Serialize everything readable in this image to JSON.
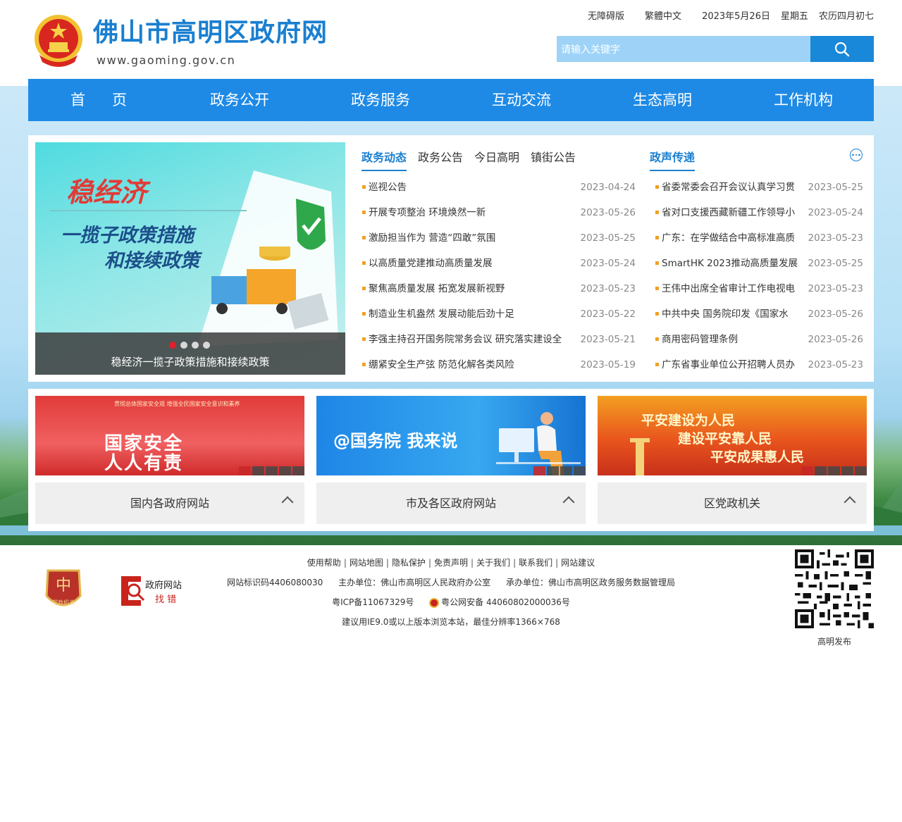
{
  "header": {
    "site_title": "佛山市高明区政府网",
    "site_url": "www.gaoming.gov.cn",
    "top_links": {
      "accessibility": "无障碍版",
      "traditional": "繁體中文",
      "date": "2023年5月26日",
      "weekday": "星期五",
      "lunar": "农历四月初七"
    },
    "search": {
      "placeholder": "请输入关键字"
    }
  },
  "nav": {
    "items": [
      "首页",
      "政务公开",
      "政务服务",
      "互动交流",
      "生态高明",
      "工作机构"
    ]
  },
  "banner": {
    "title": "稳经济",
    "subtitle_line1": "一揽子政策措施",
    "subtitle_line2": "和接续政策",
    "caption": "稳经济一揽子政策措施和接续政策",
    "slide_count": 4,
    "active_slide": 1
  },
  "news_tabs": {
    "left": [
      "政务动态",
      "政务公告",
      "今日高明",
      "镇街公告"
    ],
    "right": [
      "政声传递"
    ]
  },
  "news_left": [
    {
      "title": "巡视公告",
      "date": "2023-04-24"
    },
    {
      "title": "开展专项整治 环境焕然一新",
      "date": "2023-05-26"
    },
    {
      "title": "激励担当作为 营造“四敢”氛围",
      "date": "2023-05-25"
    },
    {
      "title": "以高质量党建推动高质量发展",
      "date": "2023-05-24"
    },
    {
      "title": "聚焦高质量发展 拓宽发展新视野",
      "date": "2023-05-23"
    },
    {
      "title": "制造业生机盎然 发展动能后劲十足",
      "date": "2023-05-22"
    },
    {
      "title": "李强主持召开国务院常务会议 研究落实建设全",
      "date": "2023-05-21"
    },
    {
      "title": "绷紧安全生产弦 防范化解各类风险",
      "date": "2023-05-19"
    }
  ],
  "news_right": [
    {
      "title": "省委常委会召开会议认真学习贯",
      "date": "2023-05-25"
    },
    {
      "title": "省对口支援西藏新疆工作领导小",
      "date": "2023-05-24"
    },
    {
      "title": "广东：在学做结合中高标准高质",
      "date": "2023-05-23"
    },
    {
      "title": "SmartHK 2023推动高质量发展",
      "date": "2023-05-25"
    },
    {
      "title": "王伟中出席全省审计工作电视电",
      "date": "2023-05-23"
    },
    {
      "title": "中共中央 国务院印发《国家水",
      "date": "2023-05-26"
    },
    {
      "title": "商用密码管理条例",
      "date": "2023-05-26"
    },
    {
      "title": "广东省事业单位公开招聘人员办",
      "date": "2023-05-23"
    }
  ],
  "promos": {
    "p1": {
      "top_text": "贯彻总体国家安全观 增强全民国家安全意识和素养",
      "main_line1": "国家安全",
      "main_line2": "人人有责"
    },
    "p2": {
      "main": "@国务院  我来说"
    },
    "p3": {
      "line1": "平安建设为人民",
      "line2": "建设平安靠人民",
      "line3": "平安成果惠人民"
    }
  },
  "dropdowns": [
    "国内各政府网站",
    "市及各区政府网站",
    "区党政机关"
  ],
  "footer": {
    "links": [
      "使用帮助",
      "网站地图",
      "隐私保护",
      "免责声明",
      "关于我们",
      "联系我们",
      "网站建议"
    ],
    "site_id": "网站标识码4406080030",
    "sponsor": "主办单位：佛山市高明区人民政府办公室",
    "organizer": "承办单位：佛山市高明区政务服务数据管理局",
    "icp": "粤ICP备11067329号",
    "police": "粤公网安备 44060802000036号",
    "browser_note": "建议用IE9.0或以上版本浏览本站，最佳分辨率1366×768",
    "qr_label": "高明发布",
    "party_badge_text": "党政机关",
    "error_badge_line1": "政府网站",
    "error_badge_line2": "找 错"
  },
  "colors": {
    "brand_blue": "#1e8ae6",
    "title_blue": "#1a7fd0",
    "accent_red": "#e0202a",
    "bullet_orange": "#f0a020"
  }
}
